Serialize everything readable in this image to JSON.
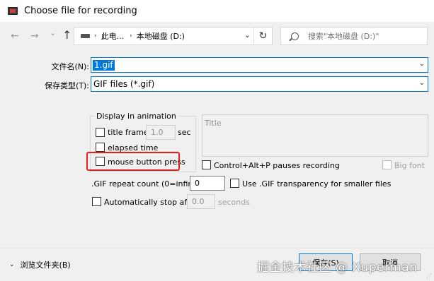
{
  "window": {
    "title": "Choose file for recording"
  },
  "addressbar": {
    "back_glyph": "←",
    "forward_glyph": "→",
    "dropdown_glyph": "⌄",
    "up_glyph": "↑",
    "crumbs": [
      "此电...",
      "本地磁盘 (D:)"
    ],
    "crumb_sep": "›",
    "path_dropdown": "⌄",
    "refresh_glyph": "↻",
    "search_placeholder": "搜索\"本地磁盘 (D:)\""
  },
  "filename": {
    "label": "文件名(N):",
    "value": "1.gif",
    "dropdown": "⌄"
  },
  "filetype": {
    "label": "保存类型(T):",
    "value": "GIF files (*.gif)",
    "dropdown": "⌄"
  },
  "animation_group": {
    "title": "Display in animation",
    "title_frame": {
      "label": "title frame:",
      "value": "1.0",
      "unit": "sec",
      "checked": false
    },
    "elapsed_time": {
      "label": "elapsed time",
      "checked": false
    },
    "mouse_button_press": {
      "label": "mouse button press",
      "checked": false
    }
  },
  "title_memo": {
    "placeholder": "Title"
  },
  "hotkey_option": {
    "label": "Control+Alt+P pauses recording",
    "checked": false
  },
  "big_font": {
    "label": "Big font",
    "checked": false
  },
  "repeat": {
    "label": ".GIF repeat count (0=infinite):",
    "value": "0"
  },
  "transparency": {
    "label": "Use .GIF transparency for smaller files",
    "checked": false
  },
  "autostop": {
    "label": "Automatically stop after",
    "value": "0.0",
    "unit": "seconds",
    "checked": false
  },
  "footer": {
    "browse_label": "浏览文件夹(B)",
    "browse_chevron": "⌄",
    "save_label": "保存(S)",
    "cancel_label": "取消",
    "watermark": "掘金技术社区 @ Xuperman"
  },
  "colors": {
    "accent": "#0078d7",
    "highlight": "#e02020"
  }
}
